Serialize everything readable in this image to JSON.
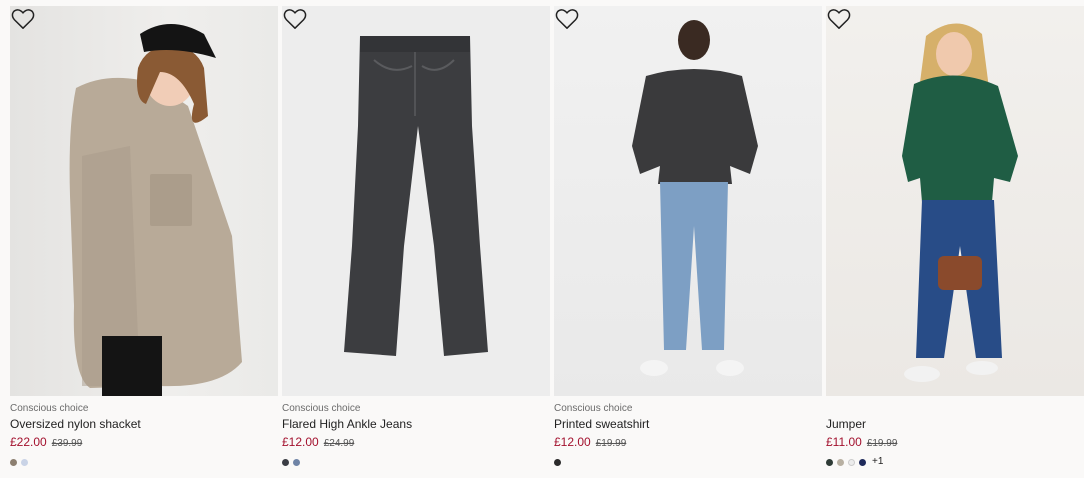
{
  "products": [
    {
      "tag": "Conscious choice",
      "name": "Oversized nylon shacket",
      "price": "£22.00",
      "old_price": "£39.99",
      "swatches": [
        "#8c7f70",
        "#c9d3e6"
      ],
      "more": ""
    },
    {
      "tag": "Conscious choice",
      "name": "Flared High Ankle Jeans",
      "price": "£12.00",
      "old_price": "£24.99",
      "swatches": [
        "#3a3d44",
        "#6f84a6"
      ],
      "more": ""
    },
    {
      "tag": "Conscious choice",
      "name": "Printed sweatshirt",
      "price": "£12.00",
      "old_price": "£19.99",
      "swatches": [
        "#2b2b2b"
      ],
      "more": ""
    },
    {
      "tag": "",
      "name": "Jumper",
      "price": "£11.00",
      "old_price": "£19.99",
      "swatches": [
        "#2e3b36",
        "#b8b0a2",
        "#ececec",
        "#1e2a5a"
      ],
      "more": "+1"
    }
  ],
  "icons": {
    "favourite": "heart-outline-icon"
  },
  "colors": {
    "sale_price": "#a3112e",
    "background": "#faf9f8"
  }
}
